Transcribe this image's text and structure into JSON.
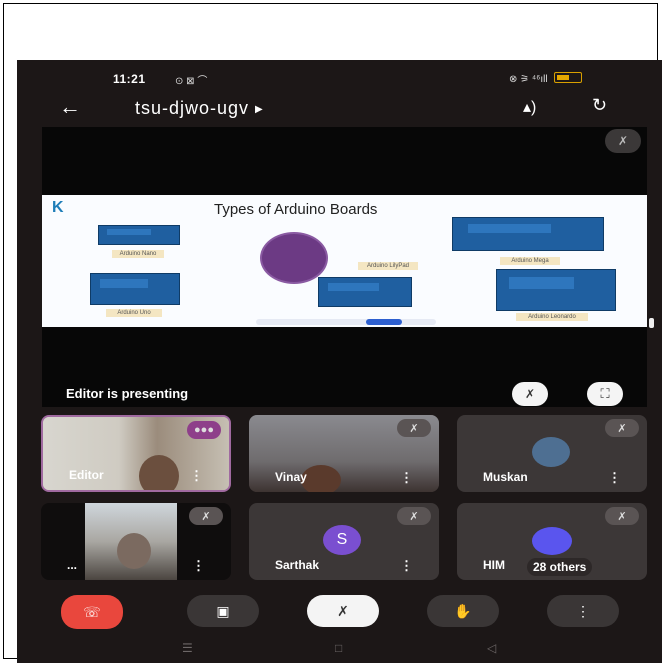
{
  "status": {
    "time": "11:21",
    "left_icons": "⊙ ⊠ ⌒",
    "right_icons": "⊗ ⚞ ⁴⁶ıll"
  },
  "meeting": {
    "code": "tsu-djwo-ugv",
    "presenting_text": "Editor is presenting"
  },
  "slide": {
    "logo": "K",
    "title": "Types of Arduino Boards",
    "labels": [
      "Arduino Nano",
      "Arduino LilyPad",
      "Arduino Mega",
      "Arduino Uno",
      "Arduino Leonardo"
    ]
  },
  "participants": [
    {
      "name": "Editor",
      "kind": "video"
    },
    {
      "name": "Vinay",
      "kind": "video"
    },
    {
      "name": "Muskan",
      "kind": "photo"
    },
    {
      "name": "...",
      "kind": "video"
    },
    {
      "name": "Sarthak",
      "kind": "initial",
      "initial": "S",
      "color": "#7a4fd0"
    },
    {
      "name": "HIM",
      "kind": "circle",
      "color": "#5a55ee",
      "others_label": "28 others"
    }
  ],
  "controls": {
    "end_icon": "phone-end",
    "camera_icon": "camera",
    "mic_icon": "mic-off",
    "hand_icon": "raise-hand",
    "more_icon": "more"
  }
}
